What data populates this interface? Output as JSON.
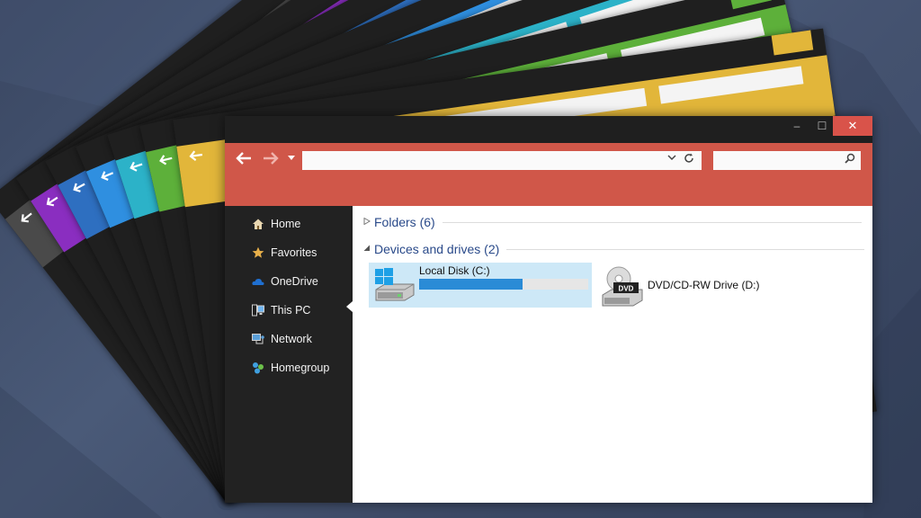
{
  "fan_windows": [
    {
      "color": "#4a4a4a"
    },
    {
      "color": "#8a2ec0"
    },
    {
      "color": "#2e6fc0"
    },
    {
      "color": "#2f8fe0"
    },
    {
      "color": "#2cb2c8"
    },
    {
      "color": "#5db03a"
    },
    {
      "color": "#e2b63a"
    }
  ],
  "window": {
    "accent": "#d05749",
    "title_buttons": {
      "minimize": "–",
      "maximize": "☐",
      "close": "✕"
    },
    "nav": {
      "back": "🡐",
      "forward": "🡒",
      "history": "▼"
    },
    "address": {
      "value": "",
      "dropdown": "⌄",
      "refresh": "↻"
    },
    "search": {
      "value": "",
      "icon": "⌕"
    }
  },
  "sidebar": {
    "items": [
      {
        "label": "Home",
        "icon": "home-icon"
      },
      {
        "label": "Favorites",
        "icon": "star-icon"
      },
      {
        "label": "OneDrive",
        "icon": "cloud-icon"
      },
      {
        "label": "This PC",
        "icon": "computer-icon",
        "selected": true
      },
      {
        "label": "Network",
        "icon": "network-icon"
      },
      {
        "label": "Homegroup",
        "icon": "homegroup-icon"
      }
    ]
  },
  "content": {
    "folders_header": "Folders (6)",
    "devices_header": "Devices and drives (2)",
    "drives": [
      {
        "label": "Local Disk (C:)",
        "used_fraction": 0.61
      },
      {
        "label": "DVD/CD-RW Drive (D:)",
        "badge": "DVD"
      }
    ]
  }
}
